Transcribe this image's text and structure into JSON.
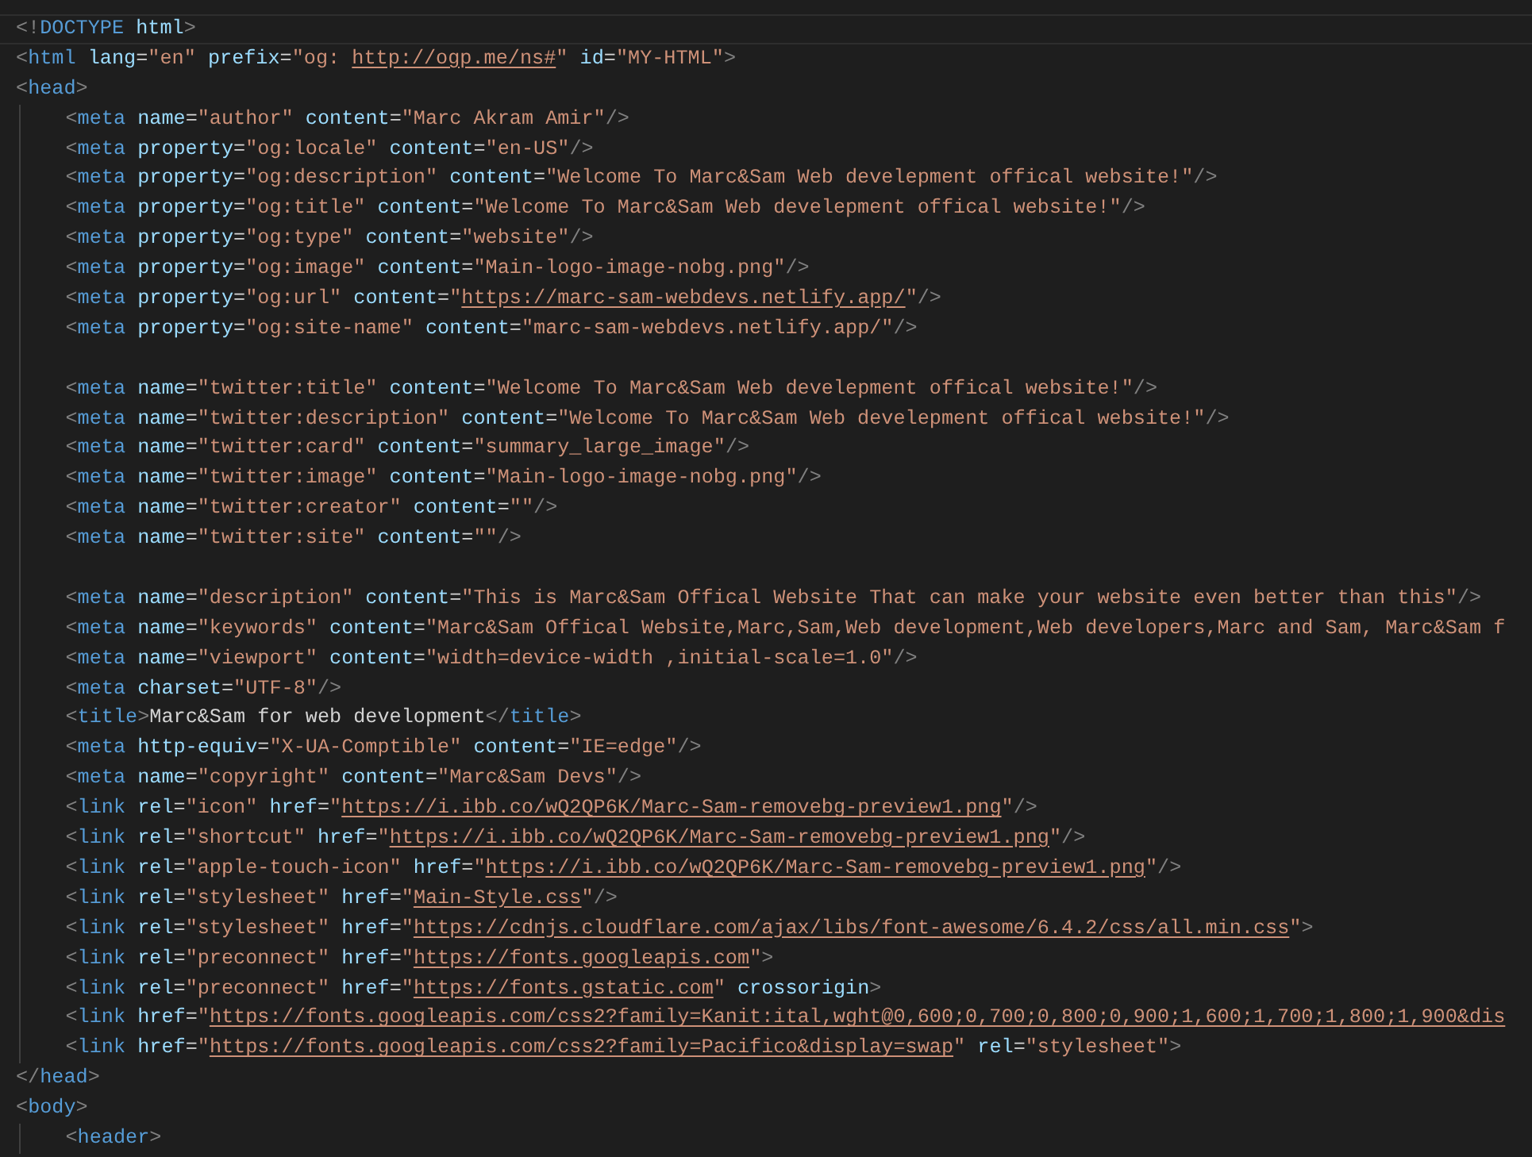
{
  "editor": {
    "lines": [
      {
        "kind": "code",
        "current": true,
        "tokens": [
          {
            "kind": "punct",
            "text": "<!"
          },
          {
            "kind": "tag",
            "text": "DOCTYPE"
          },
          {
            "kind": "attr",
            "text": " html"
          },
          {
            "kind": "punct",
            "text": ">"
          }
        ]
      },
      {
        "kind": "code",
        "current": false,
        "tokens": [
          {
            "kind": "punct",
            "text": "<"
          },
          {
            "kind": "tag",
            "text": "html"
          },
          {
            "kind": "attr",
            "text": " lang"
          },
          {
            "kind": "equals",
            "text": "="
          },
          {
            "kind": "string",
            "text": "\"en\""
          },
          {
            "kind": "attr",
            "text": " prefix"
          },
          {
            "kind": "equals",
            "text": "="
          },
          {
            "kind": "string",
            "text": "\"og: "
          },
          {
            "kind": "link",
            "text": "http://ogp.me/ns#"
          },
          {
            "kind": "string",
            "text": "\""
          },
          {
            "kind": "attr",
            "text": " id"
          },
          {
            "kind": "equals",
            "text": "="
          },
          {
            "kind": "string",
            "text": "\"MY-HTML\""
          },
          {
            "kind": "punct",
            "text": ">"
          }
        ]
      },
      {
        "kind": "code",
        "current": false,
        "tokens": [
          {
            "kind": "punct",
            "text": "<"
          },
          {
            "kind": "tag",
            "text": "head"
          },
          {
            "kind": "punct",
            "text": ">"
          }
        ],
        "children": [
          {
            "kind": "code",
            "current": false,
            "tokens": [
              {
                "kind": "punct",
                "text": "<"
              },
              {
                "kind": "tag",
                "text": "meta"
              },
              {
                "kind": "attr",
                "text": " name"
              },
              {
                "kind": "equals",
                "text": "="
              },
              {
                "kind": "string",
                "text": "\"author\""
              },
              {
                "kind": "attr",
                "text": " content"
              },
              {
                "kind": "equals",
                "text": "="
              },
              {
                "kind": "string",
                "text": "\"Marc Akram Amir\""
              },
              {
                "kind": "punct",
                "text": "/>"
              }
            ]
          },
          {
            "kind": "code",
            "current": false,
            "tokens": [
              {
                "kind": "punct",
                "text": "<"
              },
              {
                "kind": "tag",
                "text": "meta"
              },
              {
                "kind": "attr",
                "text": " property"
              },
              {
                "kind": "equals",
                "text": "="
              },
              {
                "kind": "string",
                "text": "\"og:locale\""
              },
              {
                "kind": "attr",
                "text": " content"
              },
              {
                "kind": "equals",
                "text": "="
              },
              {
                "kind": "string",
                "text": "\"en-US\""
              },
              {
                "kind": "punct",
                "text": "/>"
              }
            ]
          },
          {
            "kind": "code",
            "current": false,
            "tokens": [
              {
                "kind": "punct",
                "text": "<"
              },
              {
                "kind": "tag",
                "text": "meta"
              },
              {
                "kind": "attr",
                "text": " property"
              },
              {
                "kind": "equals",
                "text": "="
              },
              {
                "kind": "string",
                "text": "\"og:description\""
              },
              {
                "kind": "attr",
                "text": " content"
              },
              {
                "kind": "equals",
                "text": "="
              },
              {
                "kind": "string",
                "text": "\"Welcome To Marc&Sam Web develepment offical website!\""
              },
              {
                "kind": "punct",
                "text": "/>"
              }
            ]
          },
          {
            "kind": "code",
            "current": false,
            "tokens": [
              {
                "kind": "punct",
                "text": "<"
              },
              {
                "kind": "tag",
                "text": "meta"
              },
              {
                "kind": "attr",
                "text": " property"
              },
              {
                "kind": "equals",
                "text": "="
              },
              {
                "kind": "string",
                "text": "\"og:title\""
              },
              {
                "kind": "attr",
                "text": " content"
              },
              {
                "kind": "equals",
                "text": "="
              },
              {
                "kind": "string",
                "text": "\"Welcome To Marc&Sam Web develepment offical website!\""
              },
              {
                "kind": "punct",
                "text": "/>"
              }
            ]
          },
          {
            "kind": "code",
            "current": false,
            "tokens": [
              {
                "kind": "punct",
                "text": "<"
              },
              {
                "kind": "tag",
                "text": "meta"
              },
              {
                "kind": "attr",
                "text": " property"
              },
              {
                "kind": "equals",
                "text": "="
              },
              {
                "kind": "string",
                "text": "\"og:type\""
              },
              {
                "kind": "attr",
                "text": " content"
              },
              {
                "kind": "equals",
                "text": "="
              },
              {
                "kind": "string",
                "text": "\"website\""
              },
              {
                "kind": "punct",
                "text": "/>"
              }
            ]
          },
          {
            "kind": "code",
            "current": false,
            "tokens": [
              {
                "kind": "punct",
                "text": "<"
              },
              {
                "kind": "tag",
                "text": "meta"
              },
              {
                "kind": "attr",
                "text": " property"
              },
              {
                "kind": "equals",
                "text": "="
              },
              {
                "kind": "string",
                "text": "\"og:image\""
              },
              {
                "kind": "attr",
                "text": " content"
              },
              {
                "kind": "equals",
                "text": "="
              },
              {
                "kind": "string",
                "text": "\"Main-logo-image-nobg.png\""
              },
              {
                "kind": "punct",
                "text": "/>"
              }
            ]
          },
          {
            "kind": "code",
            "current": false,
            "tokens": [
              {
                "kind": "punct",
                "text": "<"
              },
              {
                "kind": "tag",
                "text": "meta"
              },
              {
                "kind": "attr",
                "text": " property"
              },
              {
                "kind": "equals",
                "text": "="
              },
              {
                "kind": "string",
                "text": "\"og:url\""
              },
              {
                "kind": "attr",
                "text": " content"
              },
              {
                "kind": "equals",
                "text": "="
              },
              {
                "kind": "string",
                "text": "\""
              },
              {
                "kind": "link",
                "text": "https://marc-sam-webdevs.netlify.app/"
              },
              {
                "kind": "string",
                "text": "\""
              },
              {
                "kind": "punct",
                "text": "/>"
              }
            ]
          },
          {
            "kind": "code",
            "current": false,
            "tokens": [
              {
                "kind": "punct",
                "text": "<"
              },
              {
                "kind": "tag",
                "text": "meta"
              },
              {
                "kind": "attr",
                "text": " property"
              },
              {
                "kind": "equals",
                "text": "="
              },
              {
                "kind": "string",
                "text": "\"og:site-name\""
              },
              {
                "kind": "attr",
                "text": " content"
              },
              {
                "kind": "equals",
                "text": "="
              },
              {
                "kind": "string",
                "text": "\"marc-sam-webdevs.netlify.app/\""
              },
              {
                "kind": "punct",
                "text": "/>"
              }
            ]
          },
          {
            "kind": "blank",
            "current": false
          },
          {
            "kind": "code",
            "current": false,
            "tokens": [
              {
                "kind": "punct",
                "text": "<"
              },
              {
                "kind": "tag",
                "text": "meta"
              },
              {
                "kind": "attr",
                "text": " name"
              },
              {
                "kind": "equals",
                "text": "="
              },
              {
                "kind": "string",
                "text": "\"twitter:title\""
              },
              {
                "kind": "attr",
                "text": " content"
              },
              {
                "kind": "equals",
                "text": "="
              },
              {
                "kind": "string",
                "text": "\"Welcome To Marc&Sam Web develepment offical website!\""
              },
              {
                "kind": "punct",
                "text": "/>"
              }
            ]
          },
          {
            "kind": "code",
            "current": false,
            "tokens": [
              {
                "kind": "punct",
                "text": "<"
              },
              {
                "kind": "tag",
                "text": "meta"
              },
              {
                "kind": "attr",
                "text": " name"
              },
              {
                "kind": "equals",
                "text": "="
              },
              {
                "kind": "string",
                "text": "\"twitter:description\""
              },
              {
                "kind": "attr",
                "text": " content"
              },
              {
                "kind": "equals",
                "text": "="
              },
              {
                "kind": "string",
                "text": "\"Welcome To Marc&Sam Web develepment offical website!\""
              },
              {
                "kind": "punct",
                "text": "/>"
              }
            ]
          },
          {
            "kind": "code",
            "current": false,
            "tokens": [
              {
                "kind": "punct",
                "text": "<"
              },
              {
                "kind": "tag",
                "text": "meta"
              },
              {
                "kind": "attr",
                "text": " name"
              },
              {
                "kind": "equals",
                "text": "="
              },
              {
                "kind": "string",
                "text": "\"twitter:card\""
              },
              {
                "kind": "attr",
                "text": " content"
              },
              {
                "kind": "equals",
                "text": "="
              },
              {
                "kind": "string",
                "text": "\"summary_large_image\""
              },
              {
                "kind": "punct",
                "text": "/>"
              }
            ]
          },
          {
            "kind": "code",
            "current": false,
            "tokens": [
              {
                "kind": "punct",
                "text": "<"
              },
              {
                "kind": "tag",
                "text": "meta"
              },
              {
                "kind": "attr",
                "text": " name"
              },
              {
                "kind": "equals",
                "text": "="
              },
              {
                "kind": "string",
                "text": "\"twitter:image\""
              },
              {
                "kind": "attr",
                "text": " content"
              },
              {
                "kind": "equals",
                "text": "="
              },
              {
                "kind": "string",
                "text": "\"Main-logo-image-nobg.png\""
              },
              {
                "kind": "punct",
                "text": "/>"
              }
            ]
          },
          {
            "kind": "code",
            "current": false,
            "tokens": [
              {
                "kind": "punct",
                "text": "<"
              },
              {
                "kind": "tag",
                "text": "meta"
              },
              {
                "kind": "attr",
                "text": " name"
              },
              {
                "kind": "equals",
                "text": "="
              },
              {
                "kind": "string",
                "text": "\"twitter:creator\""
              },
              {
                "kind": "attr",
                "text": " content"
              },
              {
                "kind": "equals",
                "text": "="
              },
              {
                "kind": "string",
                "text": "\"\""
              },
              {
                "kind": "punct",
                "text": "/>"
              }
            ]
          },
          {
            "kind": "code",
            "current": false,
            "tokens": [
              {
                "kind": "punct",
                "text": "<"
              },
              {
                "kind": "tag",
                "text": "meta"
              },
              {
                "kind": "attr",
                "text": " name"
              },
              {
                "kind": "equals",
                "text": "="
              },
              {
                "kind": "string",
                "text": "\"twitter:site\""
              },
              {
                "kind": "attr",
                "text": " content"
              },
              {
                "kind": "equals",
                "text": "="
              },
              {
                "kind": "string",
                "text": "\"\""
              },
              {
                "kind": "punct",
                "text": "/>"
              }
            ]
          },
          {
            "kind": "blank",
            "current": false
          },
          {
            "kind": "code",
            "current": false,
            "tokens": [
              {
                "kind": "punct",
                "text": "<"
              },
              {
                "kind": "tag",
                "text": "meta"
              },
              {
                "kind": "attr",
                "text": " name"
              },
              {
                "kind": "equals",
                "text": "="
              },
              {
                "kind": "string",
                "text": "\"description\""
              },
              {
                "kind": "attr",
                "text": " content"
              },
              {
                "kind": "equals",
                "text": "="
              },
              {
                "kind": "string",
                "text": "\"This is Marc&Sam Offical Website That can make your website even better than this\""
              },
              {
                "kind": "punct",
                "text": "/>"
              }
            ]
          },
          {
            "kind": "code",
            "current": false,
            "tokens": [
              {
                "kind": "punct",
                "text": "<"
              },
              {
                "kind": "tag",
                "text": "meta"
              },
              {
                "kind": "attr",
                "text": " name"
              },
              {
                "kind": "equals",
                "text": "="
              },
              {
                "kind": "string",
                "text": "\"keywords\""
              },
              {
                "kind": "attr",
                "text": " content"
              },
              {
                "kind": "equals",
                "text": "="
              },
              {
                "kind": "string",
                "text": "\"Marc&Sam Offical Website,Marc,Sam,Web development,Web developers,Marc and Sam, Marc&Sam f"
              }
            ]
          },
          {
            "kind": "code",
            "current": false,
            "tokens": [
              {
                "kind": "punct",
                "text": "<"
              },
              {
                "kind": "tag",
                "text": "meta"
              },
              {
                "kind": "attr",
                "text": " name"
              },
              {
                "kind": "equals",
                "text": "="
              },
              {
                "kind": "string",
                "text": "\"viewport\""
              },
              {
                "kind": "attr",
                "text": " content"
              },
              {
                "kind": "equals",
                "text": "="
              },
              {
                "kind": "string",
                "text": "\"width=device-width ,initial-scale=1.0\""
              },
              {
                "kind": "punct",
                "text": "/>"
              }
            ]
          },
          {
            "kind": "code",
            "current": false,
            "tokens": [
              {
                "kind": "punct",
                "text": "<"
              },
              {
                "kind": "tag",
                "text": "meta"
              },
              {
                "kind": "attr",
                "text": " charset"
              },
              {
                "kind": "equals",
                "text": "="
              },
              {
                "kind": "string",
                "text": "\"UTF-8\""
              },
              {
                "kind": "punct",
                "text": "/>"
              }
            ]
          },
          {
            "kind": "code",
            "current": false,
            "tokens": [
              {
                "kind": "punct",
                "text": "<"
              },
              {
                "kind": "tag",
                "text": "title"
              },
              {
                "kind": "punct",
                "text": ">"
              },
              {
                "kind": "text",
                "text": "Marc&Sam for web development"
              },
              {
                "kind": "punct",
                "text": "</"
              },
              {
                "kind": "tag",
                "text": "title"
              },
              {
                "kind": "punct",
                "text": ">"
              }
            ]
          },
          {
            "kind": "code",
            "current": false,
            "tokens": [
              {
                "kind": "punct",
                "text": "<"
              },
              {
                "kind": "tag",
                "text": "meta"
              },
              {
                "kind": "attr",
                "text": " http-equiv"
              },
              {
                "kind": "equals",
                "text": "="
              },
              {
                "kind": "string",
                "text": "\"X-UA-Comptible\""
              },
              {
                "kind": "attr",
                "text": " content"
              },
              {
                "kind": "equals",
                "text": "="
              },
              {
                "kind": "string",
                "text": "\"IE=edge\""
              },
              {
                "kind": "punct",
                "text": "/>"
              }
            ]
          },
          {
            "kind": "code",
            "current": false,
            "tokens": [
              {
                "kind": "punct",
                "text": "<"
              },
              {
                "kind": "tag",
                "text": "meta"
              },
              {
                "kind": "attr",
                "text": " name"
              },
              {
                "kind": "equals",
                "text": "="
              },
              {
                "kind": "string",
                "text": "\"copyright\""
              },
              {
                "kind": "attr",
                "text": " content"
              },
              {
                "kind": "equals",
                "text": "="
              },
              {
                "kind": "string",
                "text": "\"Marc&Sam Devs\""
              },
              {
                "kind": "punct",
                "text": "/>"
              }
            ]
          },
          {
            "kind": "code",
            "current": false,
            "tokens": [
              {
                "kind": "punct",
                "text": "<"
              },
              {
                "kind": "tag",
                "text": "link"
              },
              {
                "kind": "attr",
                "text": " rel"
              },
              {
                "kind": "equals",
                "text": "="
              },
              {
                "kind": "string",
                "text": "\"icon\""
              },
              {
                "kind": "attr",
                "text": " href"
              },
              {
                "kind": "equals",
                "text": "="
              },
              {
                "kind": "string",
                "text": "\""
              },
              {
                "kind": "link",
                "text": "https://i.ibb.co/wQ2QP6K/Marc-Sam-removebg-preview1.png"
              },
              {
                "kind": "string",
                "text": "\""
              },
              {
                "kind": "punct",
                "text": "/>"
              }
            ]
          },
          {
            "kind": "code",
            "current": false,
            "tokens": [
              {
                "kind": "punct",
                "text": "<"
              },
              {
                "kind": "tag",
                "text": "link"
              },
              {
                "kind": "attr",
                "text": " rel"
              },
              {
                "kind": "equals",
                "text": "="
              },
              {
                "kind": "string",
                "text": "\"shortcut\""
              },
              {
                "kind": "attr",
                "text": " href"
              },
              {
                "kind": "equals",
                "text": "="
              },
              {
                "kind": "string",
                "text": "\""
              },
              {
                "kind": "link",
                "text": "https://i.ibb.co/wQ2QP6K/Marc-Sam-removebg-preview1.png"
              },
              {
                "kind": "string",
                "text": "\""
              },
              {
                "kind": "punct",
                "text": "/>"
              }
            ]
          },
          {
            "kind": "code",
            "current": false,
            "tokens": [
              {
                "kind": "punct",
                "text": "<"
              },
              {
                "kind": "tag",
                "text": "link"
              },
              {
                "kind": "attr",
                "text": " rel"
              },
              {
                "kind": "equals",
                "text": "="
              },
              {
                "kind": "string",
                "text": "\"apple-touch-icon\""
              },
              {
                "kind": "attr",
                "text": " href"
              },
              {
                "kind": "equals",
                "text": "="
              },
              {
                "kind": "string",
                "text": "\""
              },
              {
                "kind": "link",
                "text": "https://i.ibb.co/wQ2QP6K/Marc-Sam-removebg-preview1.png"
              },
              {
                "kind": "string",
                "text": "\""
              },
              {
                "kind": "punct",
                "text": "/>"
              }
            ]
          },
          {
            "kind": "code",
            "current": false,
            "tokens": [
              {
                "kind": "punct",
                "text": "<"
              },
              {
                "kind": "tag",
                "text": "link"
              },
              {
                "kind": "attr",
                "text": " rel"
              },
              {
                "kind": "equals",
                "text": "="
              },
              {
                "kind": "string",
                "text": "\"stylesheet\""
              },
              {
                "kind": "attr",
                "text": " href"
              },
              {
                "kind": "equals",
                "text": "="
              },
              {
                "kind": "string",
                "text": "\""
              },
              {
                "kind": "link",
                "text": "Main-Style.css"
              },
              {
                "kind": "string",
                "text": "\""
              },
              {
                "kind": "punct",
                "text": "/>"
              }
            ]
          },
          {
            "kind": "code",
            "current": false,
            "tokens": [
              {
                "kind": "punct",
                "text": "<"
              },
              {
                "kind": "tag",
                "text": "link"
              },
              {
                "kind": "attr",
                "text": " rel"
              },
              {
                "kind": "equals",
                "text": "="
              },
              {
                "kind": "string",
                "text": "\"stylesheet\""
              },
              {
                "kind": "attr",
                "text": " href"
              },
              {
                "kind": "equals",
                "text": "="
              },
              {
                "kind": "string",
                "text": "\""
              },
              {
                "kind": "link",
                "text": "https://cdnjs.cloudflare.com/ajax/libs/font-awesome/6.4.2/css/all.min.css"
              },
              {
                "kind": "string",
                "text": "\""
              },
              {
                "kind": "punct",
                "text": ">"
              }
            ]
          },
          {
            "kind": "code",
            "current": false,
            "tokens": [
              {
                "kind": "punct",
                "text": "<"
              },
              {
                "kind": "tag",
                "text": "link"
              },
              {
                "kind": "attr",
                "text": " rel"
              },
              {
                "kind": "equals",
                "text": "="
              },
              {
                "kind": "string",
                "text": "\"preconnect\""
              },
              {
                "kind": "attr",
                "text": " href"
              },
              {
                "kind": "equals",
                "text": "="
              },
              {
                "kind": "string",
                "text": "\""
              },
              {
                "kind": "link",
                "text": "https://fonts.googleapis.com"
              },
              {
                "kind": "string",
                "text": "\""
              },
              {
                "kind": "punct",
                "text": ">"
              }
            ]
          },
          {
            "kind": "code",
            "current": false,
            "tokens": [
              {
                "kind": "punct",
                "text": "<"
              },
              {
                "kind": "tag",
                "text": "link"
              },
              {
                "kind": "attr",
                "text": " rel"
              },
              {
                "kind": "equals",
                "text": "="
              },
              {
                "kind": "string",
                "text": "\"preconnect\""
              },
              {
                "kind": "attr",
                "text": " href"
              },
              {
                "kind": "equals",
                "text": "="
              },
              {
                "kind": "string",
                "text": "\""
              },
              {
                "kind": "link",
                "text": "https://fonts.gstatic.com"
              },
              {
                "kind": "string",
                "text": "\""
              },
              {
                "kind": "attr",
                "text": " crossorigin"
              },
              {
                "kind": "punct",
                "text": ">"
              }
            ]
          },
          {
            "kind": "code",
            "current": false,
            "tokens": [
              {
                "kind": "punct",
                "text": "<"
              },
              {
                "kind": "tag",
                "text": "link"
              },
              {
                "kind": "attr",
                "text": " href"
              },
              {
                "kind": "equals",
                "text": "="
              },
              {
                "kind": "string",
                "text": "\""
              },
              {
                "kind": "link",
                "text": "https://fonts.googleapis.com/css2?family=Kanit:ital,wght@0,600;0,700;0,800;0,900;1,600;1,700;1,800;1,900&dis"
              }
            ]
          },
          {
            "kind": "code",
            "current": false,
            "tokens": [
              {
                "kind": "punct",
                "text": "<"
              },
              {
                "kind": "tag",
                "text": "link"
              },
              {
                "kind": "attr",
                "text": " href"
              },
              {
                "kind": "equals",
                "text": "="
              },
              {
                "kind": "string",
                "text": "\""
              },
              {
                "kind": "link",
                "text": "https://fonts.googleapis.com/css2?family=Pacifico&display=swap"
              },
              {
                "kind": "string",
                "text": "\""
              },
              {
                "kind": "attr",
                "text": " rel"
              },
              {
                "kind": "equals",
                "text": "="
              },
              {
                "kind": "string",
                "text": "\"stylesheet\""
              },
              {
                "kind": "punct",
                "text": ">"
              }
            ]
          }
        ]
      },
      {
        "kind": "code",
        "current": false,
        "tokens": [
          {
            "kind": "punct",
            "text": "</"
          },
          {
            "kind": "tag",
            "text": "head"
          },
          {
            "kind": "punct",
            "text": ">"
          }
        ]
      },
      {
        "kind": "code",
        "current": false,
        "tokens": [
          {
            "kind": "punct",
            "text": "<"
          },
          {
            "kind": "tag",
            "text": "body"
          },
          {
            "kind": "punct",
            "text": ">"
          }
        ],
        "children": [
          {
            "kind": "code",
            "current": false,
            "tokens": [
              {
                "kind": "punct",
                "text": "<"
              },
              {
                "kind": "tag",
                "text": "header"
              },
              {
                "kind": "punct",
                "text": ">"
              }
            ]
          }
        ]
      }
    ]
  }
}
